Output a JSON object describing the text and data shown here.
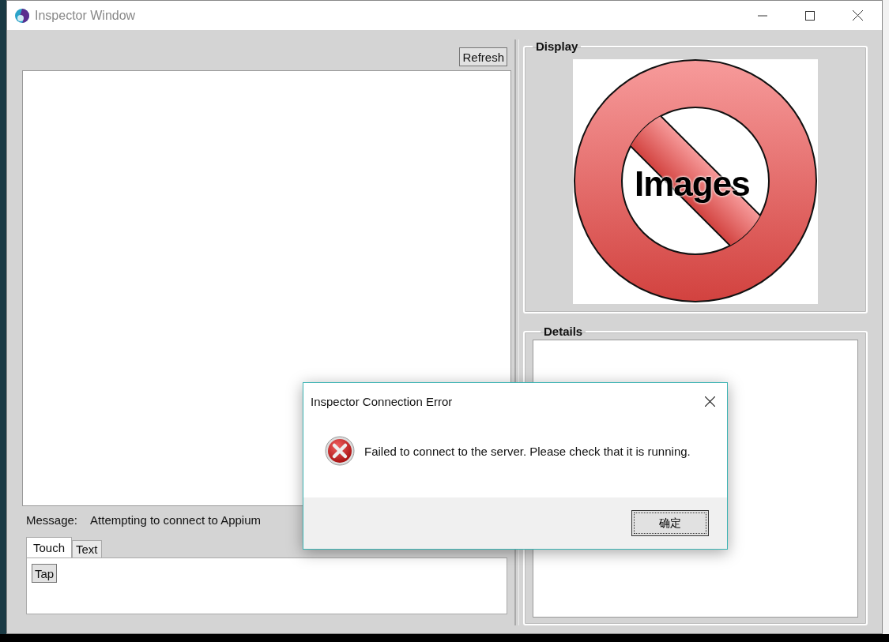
{
  "window": {
    "title": "Inspector Window"
  },
  "toolbar": {
    "refresh_button": "Refresh"
  },
  "message": {
    "label": "Message:",
    "value": "Attempting to connect to Appium"
  },
  "tabs": [
    {
      "label": "Touch",
      "selected": true
    },
    {
      "label": "Text",
      "selected": false
    }
  ],
  "touch_actions": [
    "Tap"
  ],
  "display": {
    "title": "Display",
    "image_text": "Images"
  },
  "details": {
    "title": "Details"
  },
  "dialog": {
    "title": "Inspector Connection Error",
    "message": "Failed to connect to the server. Please check that it is running.",
    "buttons": [
      "确定"
    ]
  }
}
